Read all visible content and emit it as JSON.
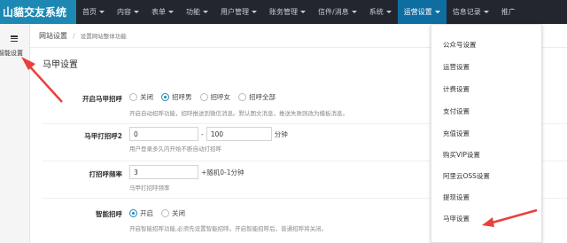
{
  "nav": {
    "brand": "山貓交友系统",
    "items": [
      {
        "label": "首页"
      },
      {
        "label": "内容"
      },
      {
        "label": "表单"
      },
      {
        "label": "功能"
      },
      {
        "label": "用户管理"
      },
      {
        "label": "账务管理"
      },
      {
        "label": "信件/消息"
      },
      {
        "label": "系统"
      },
      {
        "label": "运营设置"
      },
      {
        "label": "信息记录"
      },
      {
        "label": "推广"
      }
    ]
  },
  "sidebar": {
    "items": [
      {
        "label": "智能设置"
      }
    ]
  },
  "breadcrumb": {
    "title": "网站设置",
    "separator": "/",
    "desc": "设置网站整体功能"
  },
  "section": {
    "title": "马甲设置"
  },
  "form": {
    "greeting": {
      "label": "开启马甲招呼",
      "options": [
        "关闭",
        "招呼男",
        "招呼女",
        "招呼全部"
      ],
      "help": "开启自动招呼功能，招呼推送到微信消息。默认图文消息，推送失败则改为模板消息。"
    },
    "greeting2": {
      "label": "马甲打招呼2",
      "from": "0",
      "dash": "-",
      "to": "100",
      "unit": "分钟",
      "help": "用户登录多久内开始不断自动打招呼"
    },
    "frequency": {
      "label": "打招呼频率",
      "value": "3",
      "suffix": "+随机0-1分钟",
      "help": "马甲打招呼频率"
    },
    "smart": {
      "label": "智能招呼",
      "options": [
        "开启",
        "关闭"
      ],
      "help": "开启智能招呼功能,必须先设置智能招呼。开启智能招呼后，普通招呼将关闭。"
    }
  },
  "dropdown": {
    "items": [
      {
        "label": "公众号设置"
      },
      {
        "label": "运营设置"
      },
      {
        "label": "计费设置"
      },
      {
        "label": "支付设置"
      },
      {
        "label": "充值设置"
      },
      {
        "label": "购买VIP设置"
      },
      {
        "label": "阿里云OSS设置"
      },
      {
        "label": "提现设置"
      },
      {
        "label": "马甲设置"
      }
    ]
  },
  "colors": {
    "nav_bg": "#23262e",
    "brand_bg": "#1e88b4",
    "active_bg": "#0f6ea1",
    "arrow": "#e8413c"
  }
}
